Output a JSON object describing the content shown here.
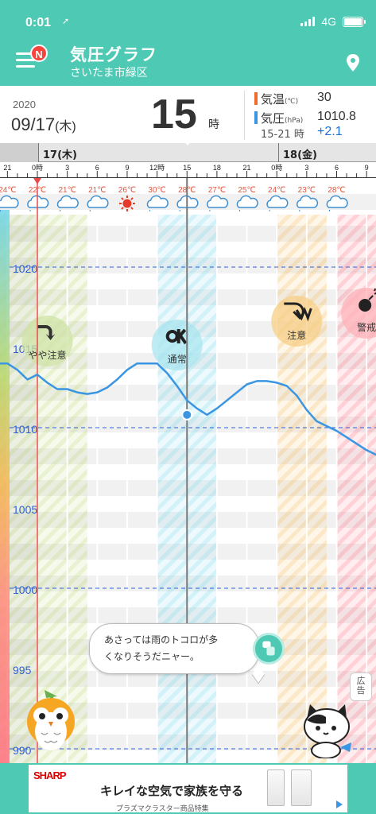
{
  "status_bar": {
    "time": "0:01",
    "network": "4G"
  },
  "header": {
    "title": "気圧グラフ",
    "location": "さいたま市緑区",
    "badge": "N"
  },
  "info": {
    "year": "2020",
    "date": "09/17",
    "weekday": "(木)",
    "hour": "15",
    "hour_unit": "時",
    "temp_label": "気温",
    "temp_unit": "(℃)",
    "temp_value": "30",
    "pressure_label": "気圧",
    "pressure_unit": "(hPa)",
    "pressure_value": "1010.8",
    "range_label": "15-21 時",
    "range_value": "+2.1"
  },
  "colors": {
    "accent": "#4ec9b4",
    "pressure_line": "#3a96e2",
    "temp_bar": "#f26a2c",
    "pressure_bar": "#3a96e2",
    "warning": "#ff6f7d",
    "caution": "#f5b44f",
    "normal": "#6dd4e8"
  },
  "timeline": {
    "days": [
      "17(木)",
      "18(金)"
    ],
    "hour_ticks": [
      "21",
      "0時",
      "3",
      "6",
      "9",
      "12時",
      "15",
      "18",
      "21",
      "0時",
      "3",
      "6",
      "9"
    ]
  },
  "chart_data": {
    "type": "line",
    "title": "",
    "unit": "hPa",
    "yticks": [
      "1020",
      "1015",
      "1010",
      "1005",
      "1000",
      "995",
      "990"
    ],
    "yticks_dashed": [
      1020,
      1010,
      1000,
      990
    ],
    "ylim": [
      990,
      1022
    ],
    "x_hours": [
      -4,
      -3,
      -2,
      -1,
      0,
      1,
      2,
      3,
      4,
      5,
      6,
      7,
      8,
      9,
      10,
      11,
      12,
      13,
      14,
      15,
      16,
      17,
      18,
      19,
      20,
      21,
      22,
      23,
      24,
      25,
      26,
      27,
      28,
      29,
      30,
      31,
      32,
      33,
      34
    ],
    "pressure": [
      1014.0,
      1014.0,
      1013.6,
      1013.0,
      1013.3,
      1012.8,
      1012.4,
      1012.4,
      1012.2,
      1012.1,
      1012.2,
      1012.5,
      1013.0,
      1013.6,
      1014.0,
      1014.0,
      1014.0,
      1013.4,
      1012.6,
      1011.7,
      1011.2,
      1010.8,
      1011.2,
      1011.7,
      1012.2,
      1012.7,
      1012.9,
      1012.9,
      1012.8,
      1012.6,
      1012.0,
      1011.1,
      1010.4,
      1010.1,
      1009.8,
      1009.4,
      1009.0,
      1008.6,
      1008.3
    ],
    "temperatures": [
      "24℃",
      "22℃",
      "21℃",
      "21℃",
      "26℃",
      "30℃",
      "28℃",
      "27℃",
      "25℃",
      "24℃",
      "23℃",
      "28℃"
    ],
    "weather_icons": [
      "cloud-icon",
      "cloud-icon",
      "cloud-icon",
      "cloud-icon",
      "sun-icon",
      "cloud-icon",
      "cloud-icon",
      "cloud-icon",
      "cloud-icon",
      "cloud-icon",
      "cloud-icon",
      "cloud-icon"
    ],
    "current_hour": 15,
    "current_value": 1010.8,
    "zones": [
      {
        "from": -4,
        "to": 5,
        "level": "やや注意",
        "kind": "slight"
      },
      {
        "from": 12,
        "to": 18,
        "level": "通常",
        "kind": "normal"
      },
      {
        "from": 24,
        "to": 29,
        "level": "注意",
        "kind": "caution"
      },
      {
        "from": 30,
        "to": 36,
        "level": "警戒",
        "kind": "warning"
      }
    ],
    "level_labels": [
      "やや注意",
      "通常",
      "注意",
      "警戒"
    ]
  },
  "message": {
    "text_line1": "あさっては雨のトコロが多",
    "text_line2": "くなりそうだニャー。",
    "ad_tag_top": "広",
    "ad_tag_bottom": "告"
  },
  "ad": {
    "brand": "SHARP",
    "headline": "キレイな空気で家族を守る",
    "sub": "プラズマクラスター商品特集"
  }
}
